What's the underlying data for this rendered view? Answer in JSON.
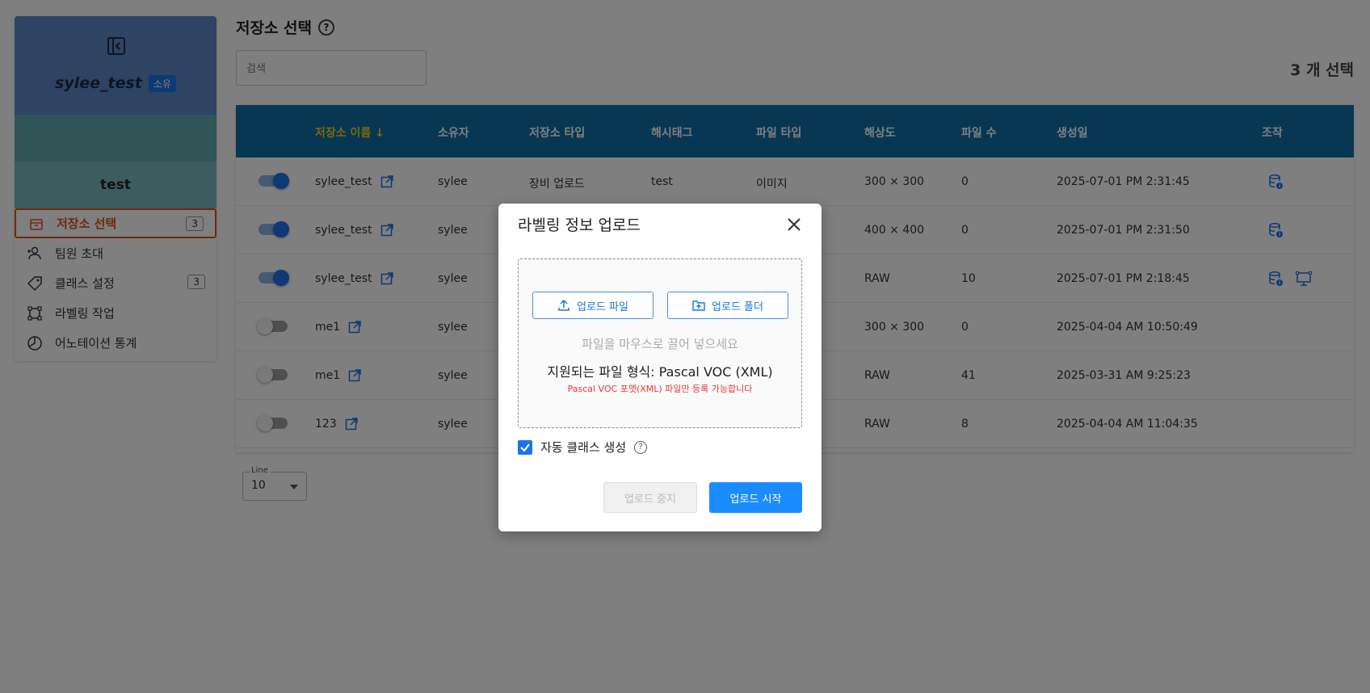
{
  "sidebar": {
    "workspace_name": "sylee_test",
    "workspace_badge": "소유",
    "project_name": "test",
    "items": [
      {
        "label": "저장소 선택",
        "count": "3",
        "icon": "box-icon"
      },
      {
        "label": "팀원 초대",
        "icon": "person-add-icon"
      },
      {
        "label": "클래스 설정",
        "count": "3",
        "icon": "tag-icon"
      },
      {
        "label": "라벨링 작업",
        "icon": "bounding-box-icon"
      },
      {
        "label": "어노테이션 통계",
        "icon": "pie-chart-icon"
      }
    ]
  },
  "main": {
    "title": "저장소 선택",
    "search_placeholder": "검색",
    "selected_count": "3 개 선택",
    "line_label": "Line",
    "line_value": "10"
  },
  "table": {
    "headers": [
      "저장소 이름",
      "소유자",
      "저장소 타입",
      "해시태그",
      "파일 타입",
      "해상도",
      "파일 수",
      "생성일",
      "조작"
    ],
    "sort_indicator": "↓",
    "rows": [
      {
        "on": true,
        "name": "sylee_test",
        "owner": "sylee",
        "type": "장비 업로드",
        "tag": "test",
        "file_type": "이미지",
        "res": "300 × 300",
        "count": "0",
        "date": "2025-07-01 PM 2:31:45"
      },
      {
        "on": true,
        "name": "sylee_test",
        "owner": "sylee",
        "type": "",
        "tag": "",
        "file_type": "",
        "res": "400 × 400",
        "count": "0",
        "date": "2025-07-01 PM 2:31:50"
      },
      {
        "on": true,
        "name": "sylee_test",
        "owner": "sylee",
        "type": "",
        "tag": "",
        "file_type": "",
        "res": "RAW",
        "count": "10",
        "date": "2025-07-01 PM 2:18:45"
      },
      {
        "on": false,
        "name": "me1",
        "owner": "sylee",
        "type": "",
        "tag": "",
        "file_type": "",
        "res": "300 × 300",
        "count": "0",
        "date": "2025-04-04 AM 10:50:49"
      },
      {
        "on": false,
        "name": "me1",
        "owner": "sylee",
        "type": "",
        "tag": "",
        "file_type": "",
        "res": "RAW",
        "count": "41",
        "date": "2025-03-31 AM 9:25:23"
      },
      {
        "on": false,
        "name": "123",
        "owner": "sylee",
        "type": "",
        "tag": "",
        "file_type": "",
        "res": "RAW",
        "count": "8",
        "date": "2025-04-04 AM 11:04:35"
      }
    ]
  },
  "modal": {
    "title": "라벨링 정보 업로드",
    "upload_file": "업로드 파일",
    "upload_folder": "업로드 폴더",
    "drop_hint": "파일을 마우스로 끌어 넣으세요",
    "format": "지원되는 파일 형식: Pascal VOC (XML)",
    "warning": "Pascal VOC 포맷(XML) 파일만 등록 가능합니다",
    "auto_class": "자동 클래스 생성",
    "stop": "업로드 중지",
    "start": "업로드 시작"
  },
  "colors": {
    "header_bg": "#0f6fa6",
    "accent": "#1a73e8",
    "active_menu": "#d9541e",
    "warning": "#e53935"
  }
}
